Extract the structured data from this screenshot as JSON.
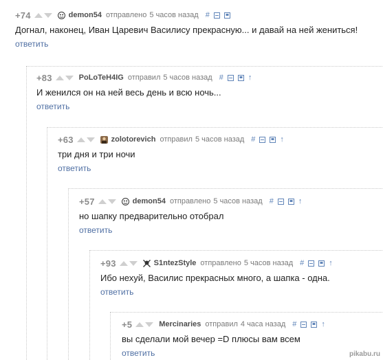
{
  "colors": {
    "link": "#4f6fa3",
    "meta": "#888888",
    "tool": "#5f84b8"
  },
  "icons": {
    "vote_up": "triangle-up-icon",
    "vote_down": "triangle-down-icon",
    "link": "hash-icon",
    "collapse": "minus-box-icon",
    "save": "bookmark-icon",
    "parent": "arrow-up-icon"
  },
  "comments": [
    {
      "rating": "+74",
      "author": "demon54",
      "action": "отправлено",
      "time": "5 часов назад",
      "text": "Догнал, наконец, Иван Царевич Василису прекрасную... и давай на ней жениться!",
      "reply": "ответить"
    },
    {
      "rating": "+83",
      "author": "PoLoTeH4IG",
      "action": "отправил",
      "time": "5 часов назад",
      "text": "И женился он на ней весь день и всю ночь...",
      "reply": "ответить"
    },
    {
      "rating": "+63",
      "author": "zolotorevich",
      "action": "отправил",
      "time": "5 часов назад",
      "text": "три дня и три ночи",
      "reply": "ответить"
    },
    {
      "rating": "+57",
      "author": "demon54",
      "action": "отправлено",
      "time": "5 часов назад",
      "text": "но шапку предварительно отобрал",
      "reply": "ответить"
    },
    {
      "rating": "+93",
      "author": "S1ntezStyle",
      "action": "отправлено",
      "time": "5 часов назад",
      "text": "Ибо нехуй, Василис прекрасных много, а шапка - одна.",
      "reply": "ответить"
    },
    {
      "rating": "+5",
      "author": "Mercinaries",
      "action": "отправил",
      "time": "4 часа назад",
      "text": "вы сделали мой вечер =D плюсы вам всем",
      "reply": "ответить"
    }
  ],
  "watermark": "pikabu.ru"
}
